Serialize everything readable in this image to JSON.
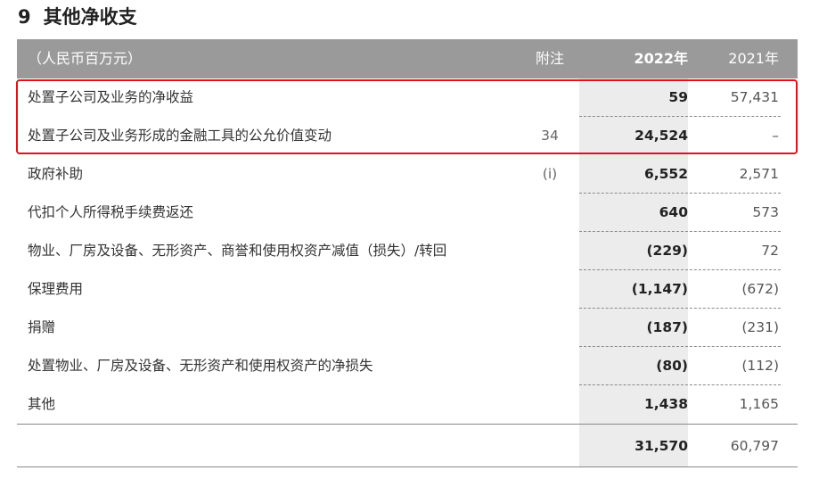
{
  "section": {
    "number": "9",
    "title": "其他净收支"
  },
  "table": {
    "headers": {
      "label": "（人民币百万元）",
      "note": "附注",
      "y2022": "2022年",
      "y2021": "2021年"
    },
    "rows": [
      {
        "label": "处置子公司及业务的净收益",
        "note": "",
        "y2022": "59",
        "y2021": "57,431"
      },
      {
        "label": "处置子公司及业务形成的金融工具的公允价值变动",
        "note": "34",
        "y2022": "24,524",
        "y2021": "–"
      },
      {
        "label": "政府补助",
        "note": "(i)",
        "y2022": "6,552",
        "y2021": "2,571"
      },
      {
        "label": "代扣个人所得税手续费返还",
        "note": "",
        "y2022": "640",
        "y2021": "573"
      },
      {
        "label": "物业、厂房及设备、无形资产、商誉和使用权资产减值（损失）/转回",
        "note": "",
        "y2022": "(229)",
        "y2021": "72"
      },
      {
        "label": "保理费用",
        "note": "",
        "y2022": "(1,147)",
        "y2021": "(672)"
      },
      {
        "label": "捐赠",
        "note": "",
        "y2022": "(187)",
        "y2021": "(231)"
      },
      {
        "label": "处置物业、厂房及设备、无形资产和使用权资产的净损失",
        "note": "",
        "y2022": "(80)",
        "y2021": "(112)"
      },
      {
        "label": "其他",
        "note": "",
        "y2022": "1,438",
        "y2021": "1,165"
      }
    ],
    "total": {
      "y2022": "31,570",
      "y2021": "60,797"
    }
  },
  "colors": {
    "header_bg": "#9a9a9a",
    "shade": "#ececec",
    "highlight": "#e3101c"
  }
}
